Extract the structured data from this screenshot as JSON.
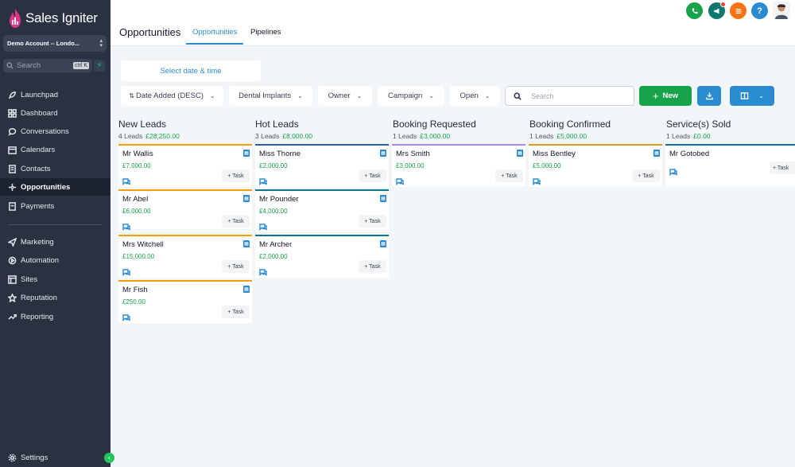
{
  "app": {
    "logo_text": "Sales Igniter",
    "account": "Demo Account -- Londo...",
    "search_placeholder": "Search",
    "search_shortcut": "ctrl K"
  },
  "sidebar": {
    "items": [
      {
        "label": "Launchpad",
        "icon": "rocket-icon"
      },
      {
        "label": "Dashboard",
        "icon": "grid-icon"
      },
      {
        "label": "Conversations",
        "icon": "chat-icon"
      },
      {
        "label": "Calendars",
        "icon": "calendar-icon"
      },
      {
        "label": "Contacts",
        "icon": "contacts-icon"
      },
      {
        "label": "Opportunities",
        "icon": "opportunities-icon",
        "active": true
      },
      {
        "label": "Payments",
        "icon": "payments-icon"
      },
      {
        "label": "Marketing",
        "icon": "send-icon"
      },
      {
        "label": "Automation",
        "icon": "automation-icon"
      },
      {
        "label": "Sites",
        "icon": "sites-icon"
      },
      {
        "label": "Reputation",
        "icon": "star-icon"
      },
      {
        "label": "Reporting",
        "icon": "trend-icon"
      }
    ],
    "settings": "Settings"
  },
  "header": {
    "title": "Opportunities",
    "tabs": [
      "Opportunities",
      "Pipelines"
    ]
  },
  "toolbar": {
    "date_picker": "Select date & time",
    "filters": [
      "Date Added (DESC)",
      "Dental Implants",
      "Owner",
      "Campaign",
      "Open"
    ],
    "search_placeholder": "Search",
    "new_label": "New"
  },
  "colors": {
    "accent": "#2b8bd1",
    "green": "#16a34a",
    "orange": "#f59e0b",
    "sidebar": "#2a3242"
  },
  "columns": [
    {
      "title": "New Leads",
      "count": "4 Leads",
      "amount": "£28,250.00",
      "cards": [
        {
          "name": "Mr Wallis",
          "amount": "£7,000.00"
        },
        {
          "name": "Mr Abel",
          "amount": "£6,000.00"
        },
        {
          "name": "Mrs Witchell",
          "amount": "£15,000.00"
        },
        {
          "name": "Mr Fish",
          "amount": "£250.00"
        }
      ]
    },
    {
      "title": "Hot Leads",
      "count": "3 Leads",
      "amount": "£8,000.00",
      "cards": [
        {
          "name": "Miss Thorne",
          "amount": "£2,000.00"
        },
        {
          "name": "Mr Pounder",
          "amount": "£4,000.00"
        },
        {
          "name": "Mr Archer",
          "amount": "£2,000.00"
        }
      ]
    },
    {
      "title": "Booking Requested",
      "count": "1 Leads",
      "amount": "£3,000.00",
      "cards": [
        {
          "name": "Mrs Smith",
          "amount": "£3,000.00"
        }
      ]
    },
    {
      "title": "Booking Confirmed",
      "count": "1 Leads",
      "amount": "£5,000.00",
      "cards": [
        {
          "name": "Miss Bentley",
          "amount": "£5,000.00"
        }
      ]
    },
    {
      "title": "Service(s) Sold",
      "count": "1 Leads",
      "amount": "£0.00",
      "cards": [
        {
          "name": "Mr Gotobed",
          "amount": ""
        }
      ]
    }
  ],
  "task_label": "+ Task"
}
